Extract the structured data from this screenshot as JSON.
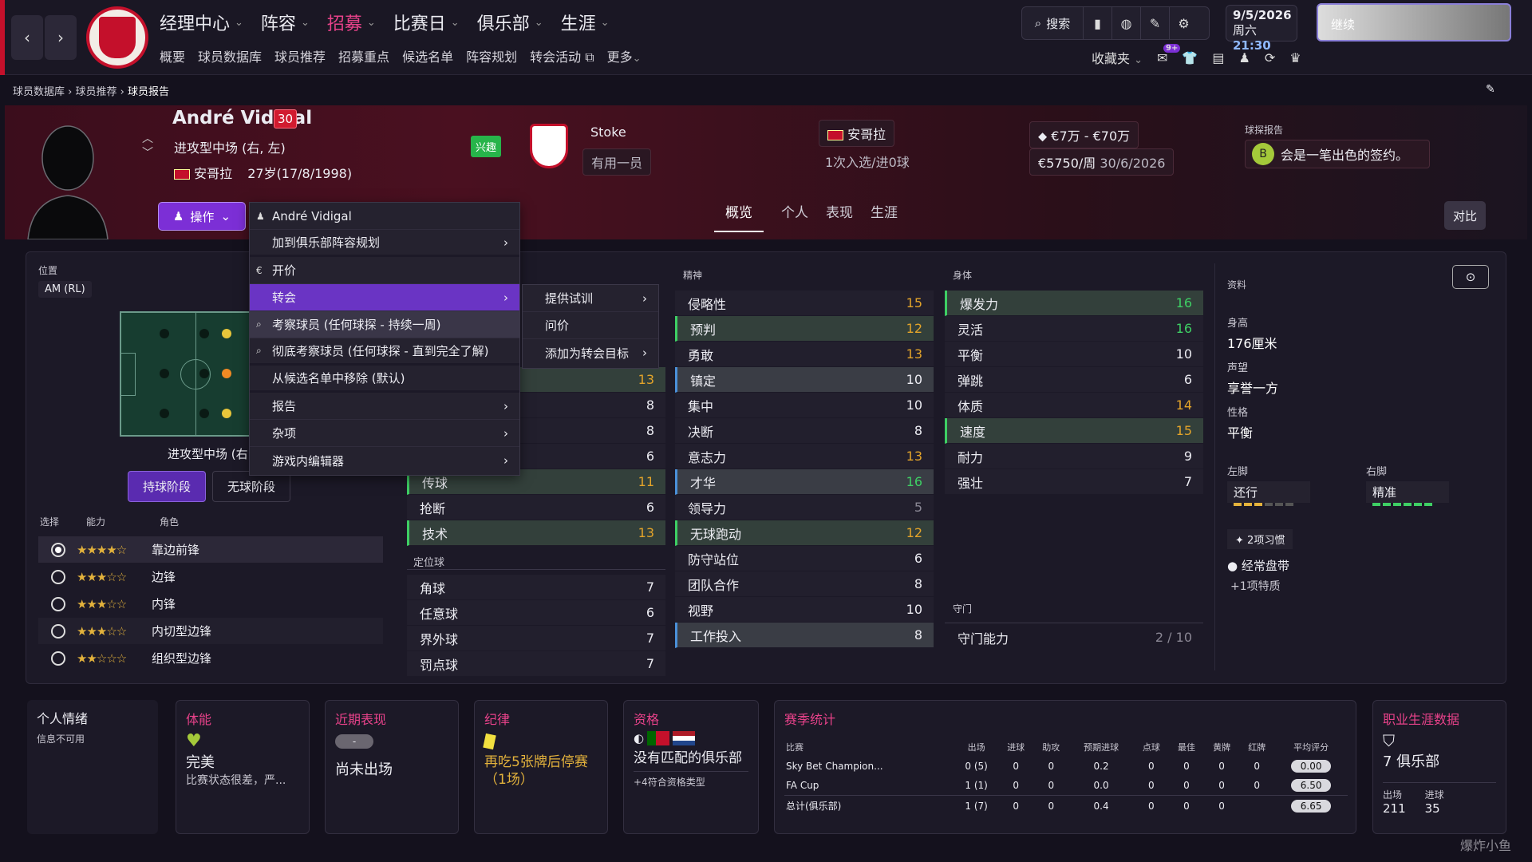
{
  "topnav": {
    "menu": [
      "经理中心",
      "阵容",
      "招募",
      "比赛日",
      "俱乐部",
      "生涯"
    ],
    "submenu": [
      "概要",
      "球员数据库",
      "球员推荐",
      "招募重点",
      "候选名单",
      "阵容规划",
      "转会活动",
      "更多"
    ],
    "search": "搜索",
    "date": "9/5/2026",
    "weekday": "周六",
    "time": "21:30",
    "continue": "继续",
    "favorites": "收藏夹",
    "notif_badge": "9+"
  },
  "breadcrumb": [
    "球员数据库",
    "球员推荐",
    "球员报告"
  ],
  "player": {
    "name": "André Vidigal",
    "age_badge": "30",
    "position": "进攻型中场 (右, 左)",
    "nation": "安哥拉",
    "age_dob": "27岁(17/8/1998)",
    "interest": "兴趣",
    "club": "Stoke",
    "club_status": "有用一员",
    "nat_team": "安哥拉",
    "caps": "1次入选/进0球",
    "value": "€7万 - €70万",
    "wage": "€5750/周",
    "contract": "30/6/2026",
    "report_label": "球探报告",
    "report_grade": "B",
    "report_text": "会是一笔出色的签约。"
  },
  "actions": {
    "op_button": "操作",
    "tabs": [
      "概览",
      "个人",
      "表现",
      "生涯"
    ],
    "compare": "对比"
  },
  "context_menu": {
    "items": [
      {
        "label": "André Vidigal",
        "arrow": false
      },
      {
        "label": "加到俱乐部阵容规划",
        "arrow": true
      },
      {
        "label": "开价",
        "arrow": false
      },
      {
        "label": "转会",
        "arrow": true
      },
      {
        "label": "考察球员 (任何球探 - 持续一周)",
        "arrow": false
      },
      {
        "label": "彻底考察球员 (任何球探 - 直到完全了解)",
        "arrow": false
      },
      {
        "label": "从候选名单中移除 (默认)",
        "arrow": false
      },
      {
        "label": "报告",
        "arrow": true
      },
      {
        "label": "杂项",
        "arrow": true
      },
      {
        "label": "游戏内编辑器",
        "arrow": true
      }
    ],
    "submenu": [
      "提供试训",
      "问价",
      "添加为转会目标"
    ]
  },
  "position_panel": {
    "label": "位置",
    "pos_code": "AM (RL)",
    "pitch_caption": "进攻型中场 (右",
    "phases": [
      "持球阶段",
      "无球阶段"
    ],
    "role_headers": [
      "选择",
      "能力",
      "角色"
    ],
    "roles": [
      {
        "stars": "★★★★☆",
        "name": "靠边前锋",
        "selected": true
      },
      {
        "stars": "★★★☆☆",
        "name": "边锋",
        "selected": false
      },
      {
        "stars": "★★★☆☆",
        "name": "内锋",
        "selected": false
      },
      {
        "stars": "★★★☆☆",
        "name": "内切型边锋",
        "selected": false
      },
      {
        "stars": "★★☆☆☆",
        "name": "组织型边锋",
        "selected": false
      }
    ]
  },
  "technical": {
    "hidden_values": [
      {
        "value": "13",
        "tone": "y",
        "hl": "g"
      },
      {
        "value": "8",
        "tone": "w",
        "hl": ""
      },
      {
        "value": "8",
        "tone": "w",
        "hl": ""
      },
      {
        "value": "6",
        "tone": "w",
        "hl": ""
      }
    ],
    "visible": [
      {
        "name": "传球",
        "value": "11",
        "tone": "y",
        "hl": "g"
      },
      {
        "name": "抢断",
        "value": "6",
        "tone": "w",
        "hl": ""
      },
      {
        "name": "技术",
        "value": "13",
        "tone": "y",
        "hl": "g"
      }
    ],
    "setpiece_title": "定位球",
    "setpieces": [
      {
        "name": "角球",
        "value": "7",
        "tone": "w"
      },
      {
        "name": "任意球",
        "value": "6",
        "tone": "w"
      },
      {
        "name": "界外球",
        "value": "7",
        "tone": "w"
      },
      {
        "name": "罚点球",
        "value": "7",
        "tone": "w"
      }
    ]
  },
  "mental": {
    "title": "精神",
    "rows": [
      {
        "name": "侵略性",
        "value": "15",
        "tone": "y",
        "hl": ""
      },
      {
        "name": "预判",
        "value": "12",
        "tone": "y",
        "hl": "g"
      },
      {
        "name": "勇敢",
        "value": "13",
        "tone": "y",
        "hl": ""
      },
      {
        "name": "镇定",
        "value": "10",
        "tone": "w",
        "hl": "b"
      },
      {
        "name": "集中",
        "value": "10",
        "tone": "w",
        "hl": ""
      },
      {
        "name": "决断",
        "value": "8",
        "tone": "w",
        "hl": ""
      },
      {
        "name": "意志力",
        "value": "13",
        "tone": "y",
        "hl": ""
      },
      {
        "name": "才华",
        "value": "16",
        "tone": "g",
        "hl": "b"
      },
      {
        "name": "领导力",
        "value": "5",
        "tone": "d",
        "hl": ""
      },
      {
        "name": "无球跑动",
        "value": "12",
        "tone": "y",
        "hl": "g"
      },
      {
        "name": "防守站位",
        "value": "6",
        "tone": "w",
        "hl": ""
      },
      {
        "name": "团队合作",
        "value": "8",
        "tone": "w",
        "hl": ""
      },
      {
        "name": "视野",
        "value": "10",
        "tone": "w",
        "hl": ""
      },
      {
        "name": "工作投入",
        "value": "8",
        "tone": "w",
        "hl": "b"
      }
    ]
  },
  "physical": {
    "title": "身体",
    "rows": [
      {
        "name": "爆发力",
        "value": "16",
        "tone": "g",
        "hl": "g"
      },
      {
        "name": "灵活",
        "value": "16",
        "tone": "g",
        "hl": ""
      },
      {
        "name": "平衡",
        "value": "10",
        "tone": "w",
        "hl": ""
      },
      {
        "name": "弹跳",
        "value": "6",
        "tone": "w",
        "hl": ""
      },
      {
        "name": "体质",
        "value": "14",
        "tone": "y",
        "hl": ""
      },
      {
        "name": "速度",
        "value": "15",
        "tone": "y",
        "hl": "g"
      },
      {
        "name": "耐力",
        "value": "9",
        "tone": "w",
        "hl": ""
      },
      {
        "name": "强壮",
        "value": "7",
        "tone": "w",
        "hl": ""
      }
    ],
    "gk_title": "守门",
    "gk_name": "守门能力",
    "gk_value": "2 / 10"
  },
  "info": {
    "title": "资料",
    "height_lbl": "身高",
    "height": "176厘米",
    "rep_lbl": "声望",
    "rep": "享誉一方",
    "pers_lbl": "性格",
    "pers": "平衡",
    "left_lbl": "左脚",
    "left": "还行",
    "right_lbl": "右脚",
    "right": "精准",
    "habits": "2项习惯",
    "trait": "经常盘带",
    "more_traits": "+1项特质"
  },
  "cards": {
    "mood_title": "个人情绪",
    "mood_text": "信息不可用",
    "fitness_title": "体能",
    "fitness_val": "完美",
    "fitness_desc": "比赛状态很差，严...",
    "form_title": "近期表现",
    "form_pill": "-",
    "form_val": "尚未出场",
    "disc_title": "纪律",
    "disc_val": "再吃5张牌后停赛（1场）",
    "elig_title": "资格",
    "elig_val": "没有匹配的俱乐部",
    "elig_more": "+4符合资格类型",
    "season_title": "赛季统计",
    "season_headers": [
      "比赛",
      "出场",
      "进球",
      "助攻",
      "预期进球",
      "点球",
      "最佳",
      "黄牌",
      "红牌",
      "平均评分"
    ],
    "season_rows": [
      [
        "Sky Bet Champion...",
        "0 (5)",
        "0",
        "0",
        "0.2",
        "0",
        "0",
        "0",
        "0",
        "0.00"
      ],
      [
        "FA Cup",
        "1 (1)",
        "0",
        "0",
        "0.0",
        "0",
        "0",
        "0",
        "0",
        "6.50"
      ],
      [
        "总计(俱乐部)",
        "1 (7)",
        "0",
        "0",
        "0.4",
        "0",
        "0",
        "0",
        "",
        "6.65"
      ]
    ],
    "career_title": "职业生涯数据",
    "career_clubs": "7 俱乐部",
    "career_apps_lbl": "出场",
    "career_apps": "211",
    "career_goals_lbl": "进球",
    "career_goals": "35"
  },
  "watermark": "爆炸小鱼"
}
